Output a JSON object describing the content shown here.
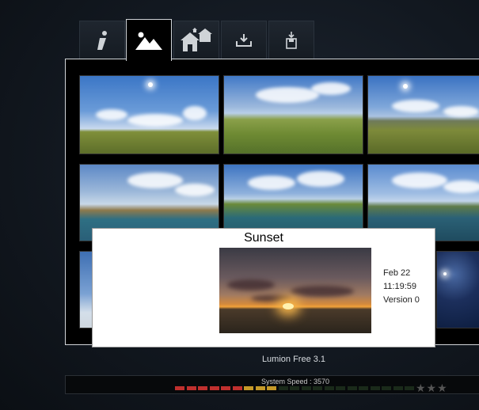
{
  "tabs": [
    {
      "id": "info",
      "icon": "info-icon"
    },
    {
      "id": "landscape",
      "icon": "mountain-icon",
      "active": true
    },
    {
      "id": "scene",
      "icon": "houses-icon"
    },
    {
      "id": "import",
      "icon": "import-icon"
    },
    {
      "id": "save",
      "icon": "save-icon"
    }
  ],
  "popup": {
    "title": "Sunset",
    "date": "Feb 22",
    "time": "11:19:59",
    "version": "Version 0"
  },
  "app_version": "Lumion Free  3.1",
  "system_speed": {
    "label": "System Speed : 3570",
    "segment_colors": [
      "#c0302e",
      "#c0302e",
      "#c0302e",
      "#c0302e",
      "#c0302e",
      "#c0302e",
      "#c69a28",
      "#c69a28",
      "#c69a28"
    ],
    "stars_filled": 0,
    "stars_total": 3
  },
  "stars_text": "★★★"
}
